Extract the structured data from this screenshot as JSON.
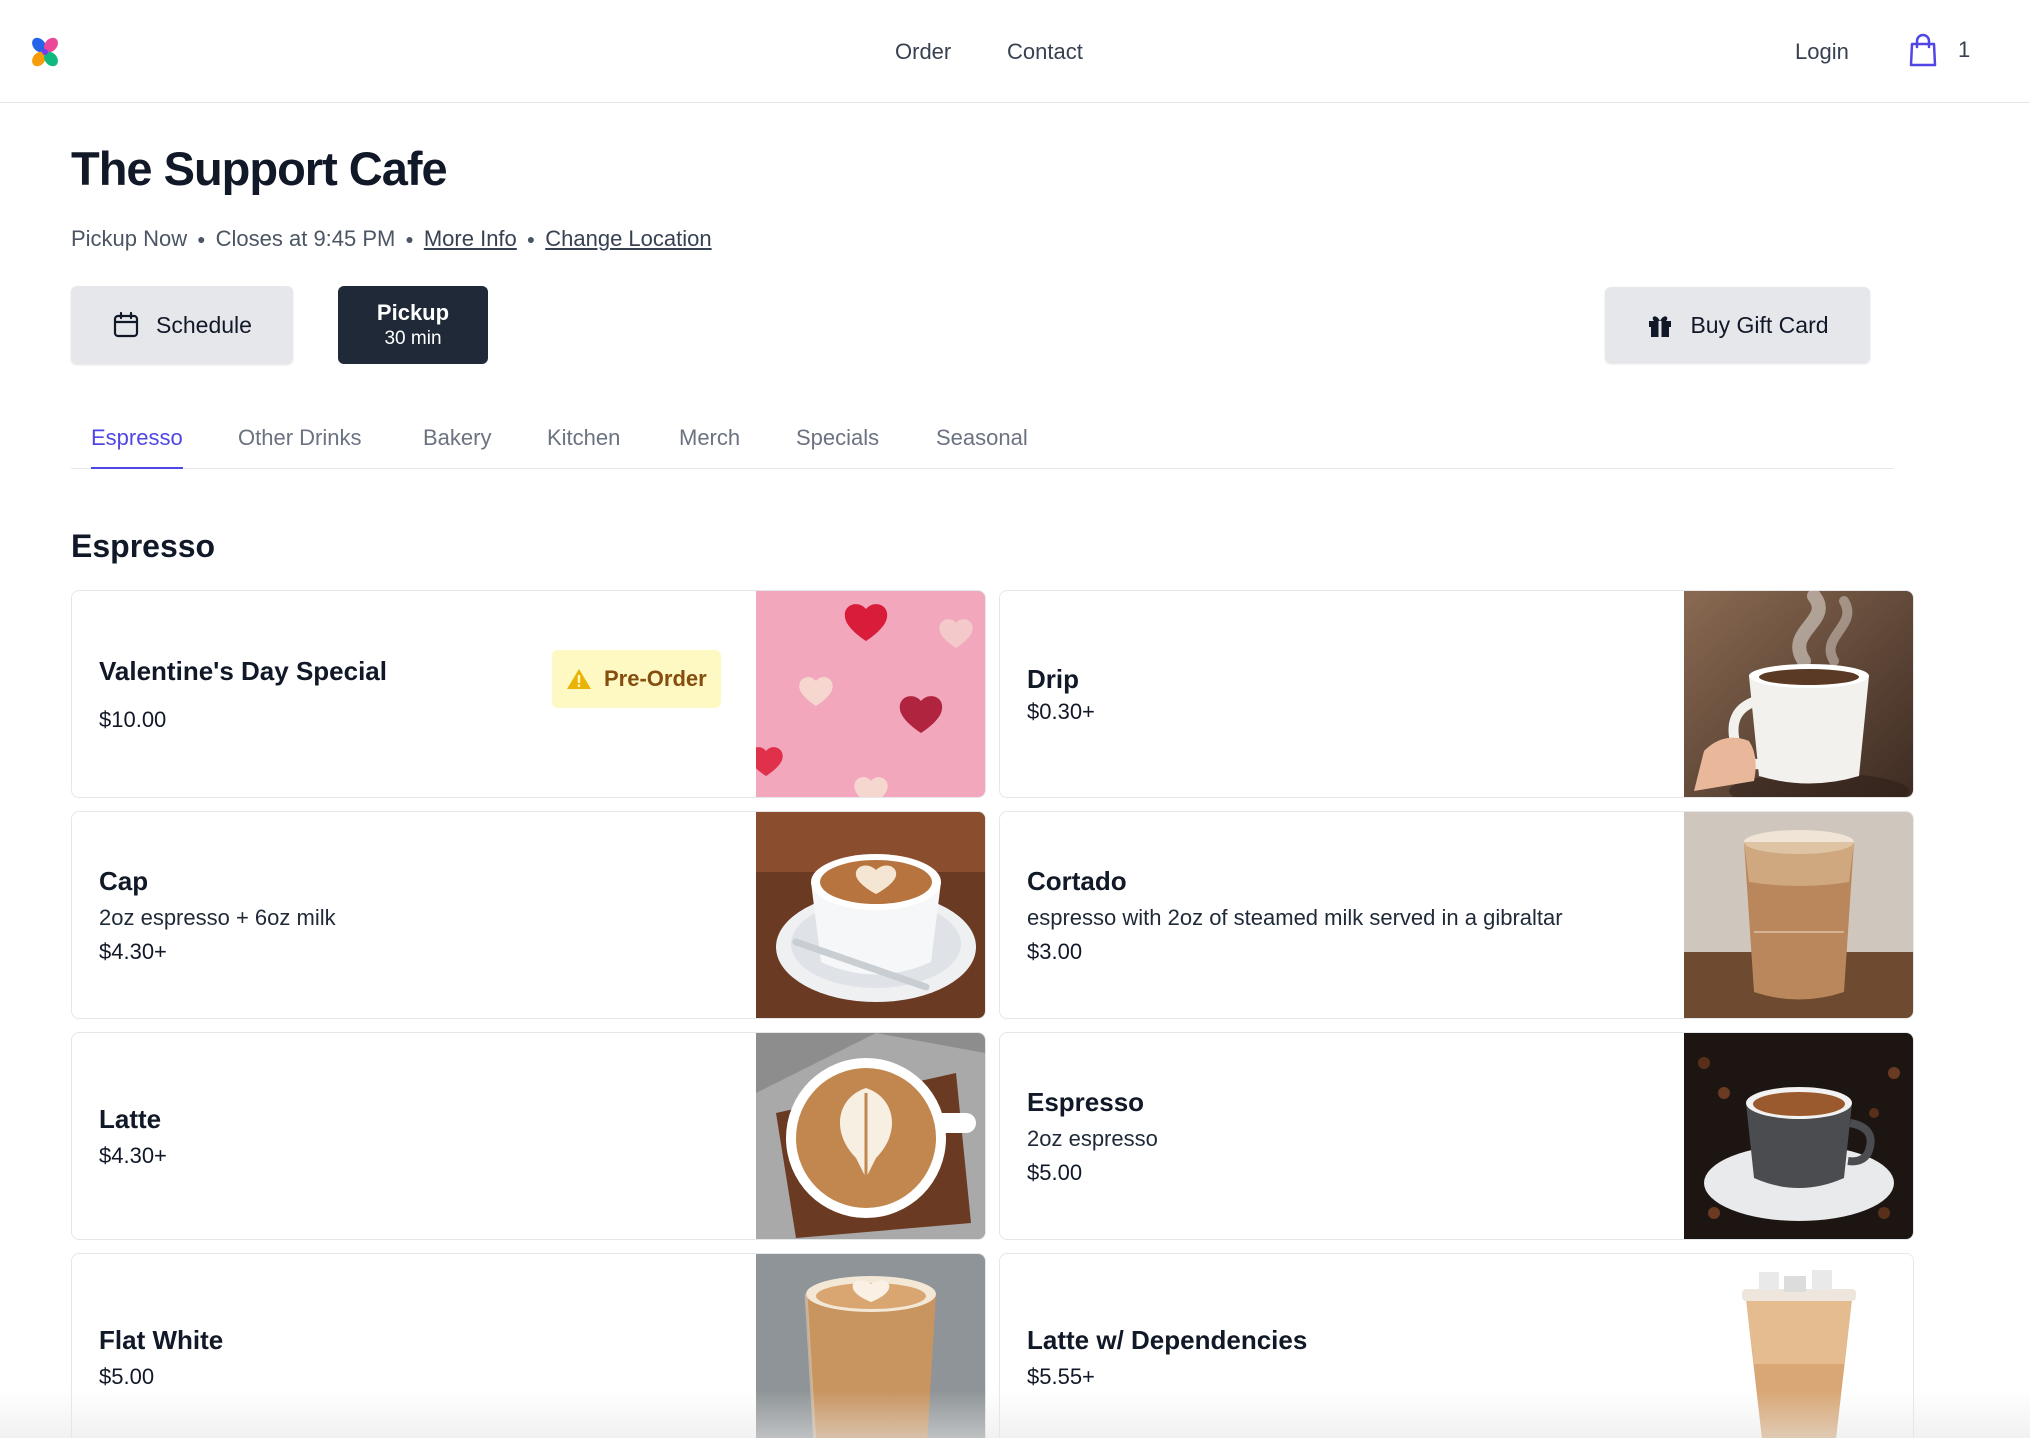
{
  "header": {
    "nav": {
      "order": "Order",
      "contact": "Contact"
    },
    "login": "Login",
    "cart_count": "1",
    "icons": {
      "logo": "flower-logo-icon",
      "cart": "shopping-bag-icon"
    }
  },
  "hero": {
    "title": "The Support Cafe",
    "status": "Pickup Now",
    "closes": "Closes at 9:45 PM",
    "more_info": "More Info",
    "change_location": "Change Location",
    "schedule_label": "Schedule",
    "pickup_label": "Pickup",
    "pickup_time": "30 min",
    "gift_card_label": "Buy Gift Card"
  },
  "tabs": [
    "Espresso",
    "Other Drinks",
    "Bakery",
    "Kitchen",
    "Merch",
    "Specials",
    "Seasonal"
  ],
  "active_tab": "Espresso",
  "section": {
    "title": "Espresso"
  },
  "items": [
    {
      "name": "Valentine's Day Special",
      "desc": "",
      "price": "$10.00",
      "badge": "Pre-Order",
      "image": "pink-hearts-photo"
    },
    {
      "name": "Drip",
      "desc": "",
      "price": "$0.30+",
      "image": "steaming-mug-photo"
    },
    {
      "name": "Cap",
      "desc": "2oz espresso + 6oz milk",
      "price": "$4.30+",
      "image": "cappuccino-cup-photo"
    },
    {
      "name": "Cortado",
      "desc": "espresso with 2oz of steamed milk served in a gibraltar",
      "price": "$3.00",
      "image": "cortado-glass-photo"
    },
    {
      "name": "Latte",
      "desc": "",
      "price": "$4.30+",
      "image": "latte-art-photo"
    },
    {
      "name": "Espresso",
      "desc": "2oz espresso",
      "price": "$5.00",
      "image": "espresso-cup-photo"
    },
    {
      "name": "Flat White",
      "desc": "",
      "price": "$5.00",
      "image": "flat-white-glass-photo"
    },
    {
      "name": "Latte w/ Dependencies",
      "desc": "",
      "price": "$5.55+",
      "image": "iced-latte-cup-photo"
    }
  ],
  "colors": {
    "accent": "#4f46e5",
    "dark_button": "#1f2937",
    "badge_bg": "#fef9c3",
    "badge_text": "#854d0e"
  }
}
